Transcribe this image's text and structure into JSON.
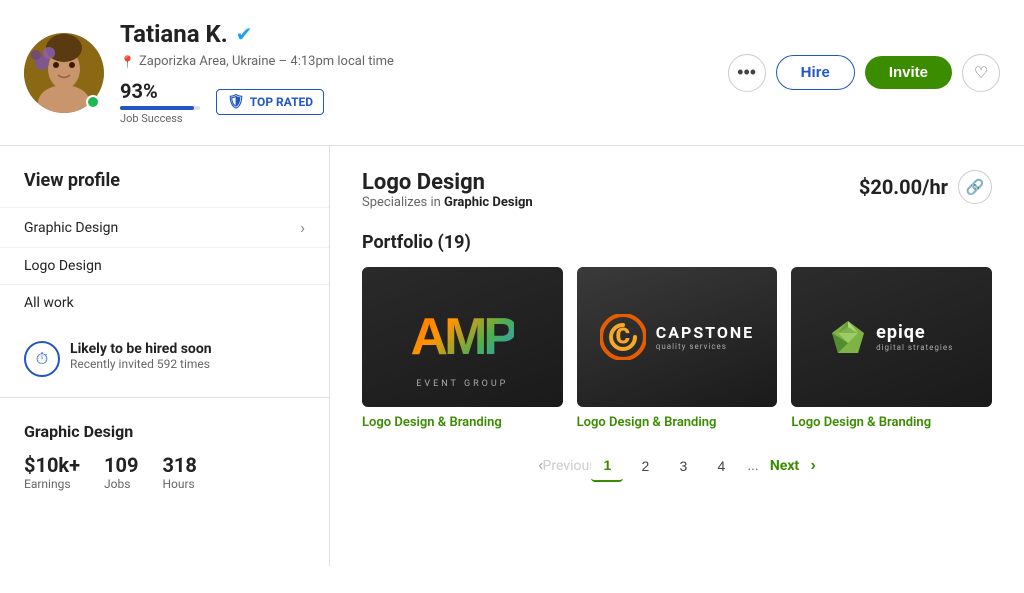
{
  "header": {
    "name": "Tatiana K.",
    "verified": true,
    "location": "Zaporizka Area, Ukraine – 4:13pm local time",
    "job_success_pct": "93%",
    "job_success_label": "Job Success",
    "progress_width": "93",
    "top_rated_label": "TOP RATED",
    "btn_more_label": "•••",
    "btn_hire_label": "Hire",
    "btn_invite_label": "Invite",
    "online": true
  },
  "sidebar": {
    "view_profile_label": "View profile",
    "nav_items": [
      {
        "label": "Graphic Design",
        "has_arrow": true
      },
      {
        "label": "Logo Design",
        "has_arrow": false
      },
      {
        "label": "All work",
        "has_arrow": false
      }
    ],
    "hire_soon": {
      "title": "Likely to be hired soon",
      "subtitle": "Recently invited 592 times"
    },
    "category_label": "Graphic Design",
    "stats": [
      {
        "value": "$10k+",
        "label": "Earnings"
      },
      {
        "value": "109",
        "label": "Jobs"
      },
      {
        "value": "318",
        "label": "Hours"
      }
    ]
  },
  "content": {
    "service_title": "Logo Design",
    "specializes_prefix": "Specializes in ",
    "specializes_bold": "Graphic Design",
    "rate": "$20.00/hr",
    "portfolio_title": "Portfolio (19)",
    "portfolio_items": [
      {
        "label": "Logo Design & Branding"
      },
      {
        "label": "Logo Design & Branding"
      },
      {
        "label": "Logo Design & Branding"
      }
    ],
    "pagination": {
      "prev_label": "Previous",
      "next_label": "Next",
      "pages": [
        "1",
        "2",
        "3",
        "4"
      ],
      "dots": "...",
      "active_page": "1"
    }
  }
}
